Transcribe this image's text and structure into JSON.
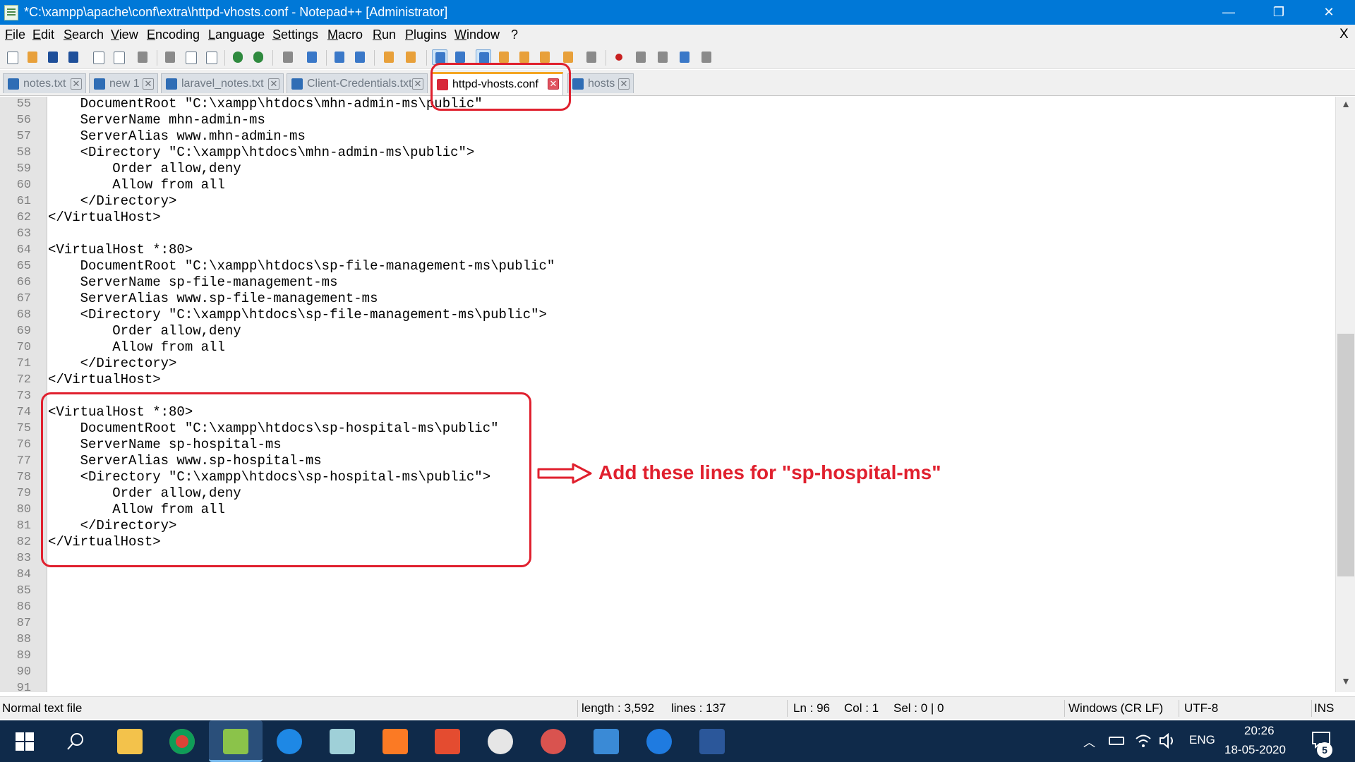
{
  "window": {
    "title": "*C:\\xampp\\apache\\conf\\extra\\httpd-vhosts.conf - Notepad++ [Administrator]",
    "minimize": "—",
    "maximize": "❐",
    "close": "✕"
  },
  "menu": [
    "File",
    "Edit",
    "Search",
    "View",
    "Encoding",
    "Language",
    "Settings",
    "Macro",
    "Run",
    "Plugins",
    "Window",
    "?"
  ],
  "menu_close": "X",
  "tabs": [
    {
      "label": "notes.txt",
      "active": false
    },
    {
      "label": "new 1",
      "active": false
    },
    {
      "label": "laravel_notes.txt",
      "active": false
    },
    {
      "label": "Client-Credentials.txt",
      "active": false
    },
    {
      "label": "httpd-vhosts.conf",
      "active": true
    },
    {
      "label": "hosts",
      "active": false
    }
  ],
  "tab_close_glyph": "✕",
  "editor": {
    "lines": [
      {
        "n": "55",
        "text": "    DocumentRoot \"C:\\xampp\\htdocs\\mhn-admin-ms\\public\""
      },
      {
        "n": "56",
        "text": "    ServerName mhn-admin-ms"
      },
      {
        "n": "57",
        "text": "    ServerAlias www.mhn-admin-ms"
      },
      {
        "n": "58",
        "text": "    <Directory \"C:\\xampp\\htdocs\\mhn-admin-ms\\public\">"
      },
      {
        "n": "59",
        "text": "        Order allow,deny"
      },
      {
        "n": "60",
        "text": "        Allow from all"
      },
      {
        "n": "61",
        "text": "    </Directory>"
      },
      {
        "n": "62",
        "text": "</VirtualHost>"
      },
      {
        "n": "63",
        "text": ""
      },
      {
        "n": "64",
        "text": "<VirtualHost *:80>"
      },
      {
        "n": "65",
        "text": "    DocumentRoot \"C:\\xampp\\htdocs\\sp-file-management-ms\\public\""
      },
      {
        "n": "66",
        "text": "    ServerName sp-file-management-ms"
      },
      {
        "n": "67",
        "text": "    ServerAlias www.sp-file-management-ms"
      },
      {
        "n": "68",
        "text": "    <Directory \"C:\\xampp\\htdocs\\sp-file-management-ms\\public\">"
      },
      {
        "n": "69",
        "text": "        Order allow,deny"
      },
      {
        "n": "70",
        "text": "        Allow from all"
      },
      {
        "n": "71",
        "text": "    </Directory>"
      },
      {
        "n": "72",
        "text": "</VirtualHost>"
      },
      {
        "n": "73",
        "text": ""
      },
      {
        "n": "74",
        "text": "<VirtualHost *:80>"
      },
      {
        "n": "75",
        "text": "    DocumentRoot \"C:\\xampp\\htdocs\\sp-hospital-ms\\public\""
      },
      {
        "n": "76",
        "text": "    ServerName sp-hospital-ms"
      },
      {
        "n": "77",
        "text": "    ServerAlias www.sp-hospital-ms"
      },
      {
        "n": "78",
        "text": "    <Directory \"C:\\xampp\\htdocs\\sp-hospital-ms\\public\">"
      },
      {
        "n": "79",
        "text": "        Order allow,deny"
      },
      {
        "n": "80",
        "text": "        Allow from all"
      },
      {
        "n": "81",
        "text": "    </Directory>"
      },
      {
        "n": "82",
        "text": "</VirtualHost>"
      },
      {
        "n": "83",
        "text": ""
      },
      {
        "n": "84",
        "text": ""
      },
      {
        "n": "85",
        "text": ""
      },
      {
        "n": "86",
        "text": ""
      },
      {
        "n": "87",
        "text": ""
      },
      {
        "n": "88",
        "text": ""
      },
      {
        "n": "89",
        "text": ""
      },
      {
        "n": "90",
        "text": ""
      },
      {
        "n": "91",
        "text": ""
      }
    ]
  },
  "annotation": {
    "text": "Add these lines for \"sp-hospital-ms\"",
    "color": "#e0202e"
  },
  "status": {
    "file_type": "Normal text file",
    "length": "length : 3,592",
    "lines": "lines : 137",
    "ln": "Ln : 96",
    "col": "Col : 1",
    "sel": "Sel : 0 | 0",
    "eol": "Windows (CR LF)",
    "encoding": "UTF-8",
    "mode": "INS"
  },
  "taskbar": {
    "apps": [
      "search-icon",
      "file-explorer-icon",
      "chrome-icon",
      "notepadpp-icon",
      "maps-icon",
      "notes-app-icon",
      "xampp-icon",
      "git-icon",
      "paint-icon",
      "snipping-icon",
      "photos-icon",
      "edge-icon",
      "word-icon"
    ],
    "language": "ENG",
    "time": "20:26",
    "date": "18-05-2020",
    "notifications": "5"
  },
  "colors": {
    "titlebar": "#0078d7",
    "active_tab_accent": "#f4a623",
    "annotation_red": "#e0202e",
    "taskbar": "#0f2a4a"
  }
}
